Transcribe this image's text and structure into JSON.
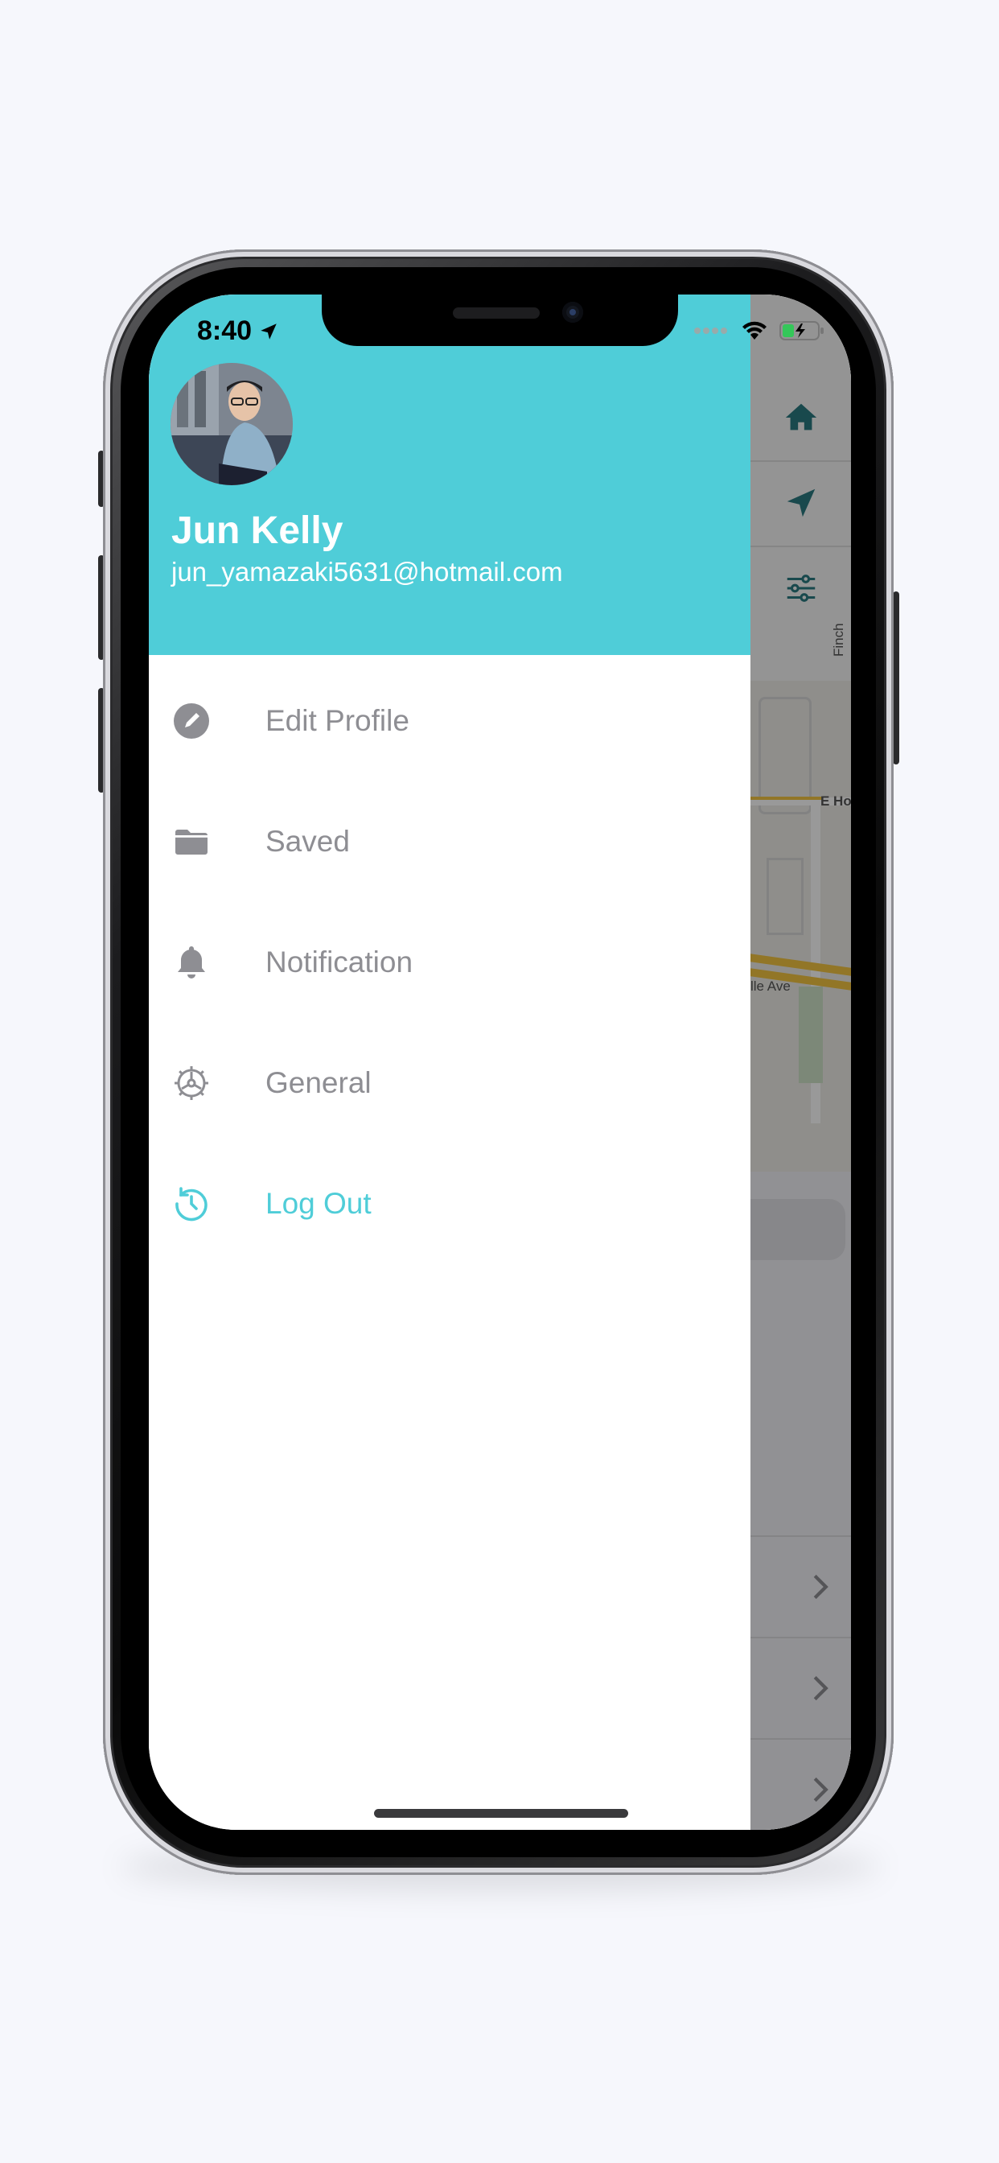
{
  "status_bar": {
    "time": "8:40"
  },
  "profile": {
    "name": "Jun Kelly",
    "email": "jun_yamazaki5631@hotmail.com"
  },
  "menu": [
    {
      "label": "Edit Profile",
      "icon": "pencil-circle-icon"
    },
    {
      "label": "Saved",
      "icon": "folder-icon"
    },
    {
      "label": "Notification",
      "icon": "bell-icon"
    },
    {
      "label": "General",
      "icon": "gear-icon"
    },
    {
      "label": "Log Out",
      "icon": "logout-icon"
    }
  ],
  "map": {
    "labels": [
      "Finch",
      "E Ho",
      "lle Ave"
    ]
  },
  "colors": {
    "accent": "#4fcdd8",
    "menu_text": "#8e8e93",
    "map_icon": "#2b7a80"
  }
}
